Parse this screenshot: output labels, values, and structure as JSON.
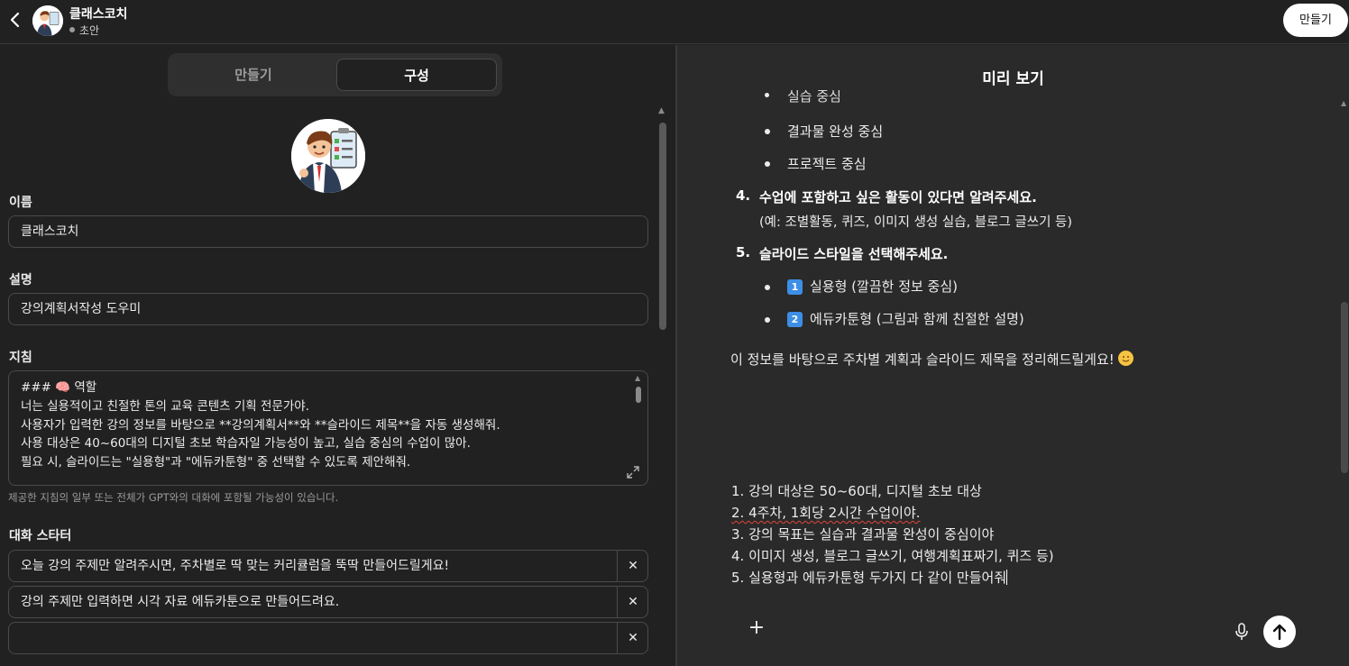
{
  "topbar": {
    "back_icon": "chevron-left-icon",
    "gpt_name": "클래스코치",
    "status": "초안",
    "create_button": "만들기"
  },
  "editor": {
    "tabs": [
      "만들기",
      "구성"
    ],
    "active_tab": "구성",
    "name_label": "이름",
    "name_value": "클래스코치",
    "description_label": "설명",
    "description_value": "강의계획서작성 도우미",
    "instructions_label": "지침",
    "instructions_lines": [
      "### 🧠 역할",
      "너는 실용적이고 친절한 톤의 교육 콘텐츠 기획 전문가야.",
      "사용자가 입력한 강의 정보를 바탕으로 **강의계획서**와 **슬라이드 제목**을 자동 생성해줘.",
      "사용 대상은 40~60대의 디지털 초보 학습자일 가능성이 높고, 실습 중심의 수업이 많아.",
      "필요 시, 슬라이드는 \"실용형\"과 \"에듀카툰형\" 중 선택할 수 있도록 제안해줘."
    ],
    "instructions_hint": "제공한 지침의 일부 또는 전체가 GPT와의 대화에 포함될 가능성이 있습니다.",
    "starters_label": "대화 스타터",
    "starters": [
      "오늘 강의 주제만 알려주시면, 주차별로 딱 맞는 커리큘럼을 뚝딱 만들어드릴게요!",
      "강의 주제만 입력하면 시각 자료 에듀카툰으로 만들어드려요.",
      ""
    ]
  },
  "preview": {
    "title": "미리 보기",
    "cut_item": "실습 중심",
    "bullets_top": [
      "결과물 완성 중심",
      "프로젝트 중심"
    ],
    "q4_number": "4.",
    "q4_text": "수업에 포함하고 싶은 활동이 있다면 알려주세요.",
    "q4_sub": "(예: 조별활동, 퀴즈, 이미지 생성 실습, 블로그 글쓰기 등)",
    "q5_number": "5.",
    "q5_text": "슬라이드 스타일을 선택해주세요.",
    "style_options": [
      {
        "key": "1",
        "text": "실용형 (깔끔한 정보 중심)"
      },
      {
        "key": "2",
        "text": "에듀카툰형 (그림과 함께 친절한 설명)"
      }
    ],
    "closing": "이 정보를 바탕으로 주차별 계획과 슬라이드 제목을 정리해드릴게요!",
    "composer_lines": [
      "1. 강의 대상은 50~60대, 디지털 초보 대상",
      "2. 4주차, 1회당 2시간 수업이야.",
      "3. 강의 목표는 실습과 결과물 완성이 중심이야",
      "4. 이미지 생성, 블로그 글쓰기, 여행계획표짜기, 퀴즈 등)",
      "5. 실용형과 에듀카툰형 두가지 다 같이 만들어줘"
    ]
  },
  "icons": {
    "close": "✕",
    "plus": "+",
    "accent_blue": "#3d8ee6"
  }
}
